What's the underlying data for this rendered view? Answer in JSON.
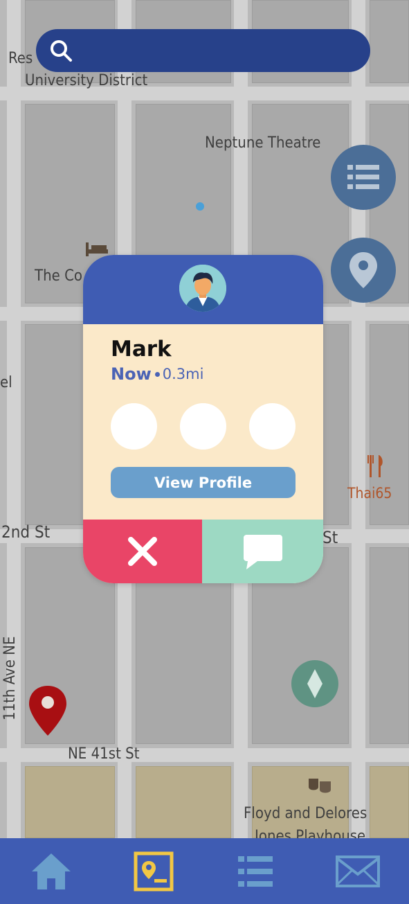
{
  "search": {
    "placeholder": "",
    "value": ""
  },
  "map": {
    "labels": {
      "university_district": "University District",
      "neptune_theatre": "Neptune Theatre",
      "the_co": "The Co",
      "res": "Res",
      "el": "el",
      "second_st": "2nd St",
      "st_right": "St",
      "thai65": "Thai65",
      "eleventh_ave": "11th Ave NE",
      "ne_41st": "NE 41st St",
      "floyd": "Floyd and Delores",
      "jones": "Jones Playhouse"
    }
  },
  "fabs": [
    {
      "icon": "list-icon"
    },
    {
      "icon": "location-pin-icon"
    }
  ],
  "card": {
    "name": "Mark",
    "status_now": "Now",
    "distance": "0.3mi",
    "view_profile_label": "View Profile",
    "colors": {
      "header": "#3f5cb3",
      "body": "#fbe9c9",
      "dismiss": "#e94567",
      "message": "#9dd9c3"
    }
  },
  "bottom_nav": {
    "items": [
      {
        "icon": "home-icon",
        "active": false
      },
      {
        "icon": "map-profile-icon",
        "active": true
      },
      {
        "icon": "list-icon",
        "active": false
      },
      {
        "icon": "mail-icon",
        "active": false
      }
    ],
    "active_color": "#f2c744",
    "inactive_color": "#6a9fcc"
  }
}
